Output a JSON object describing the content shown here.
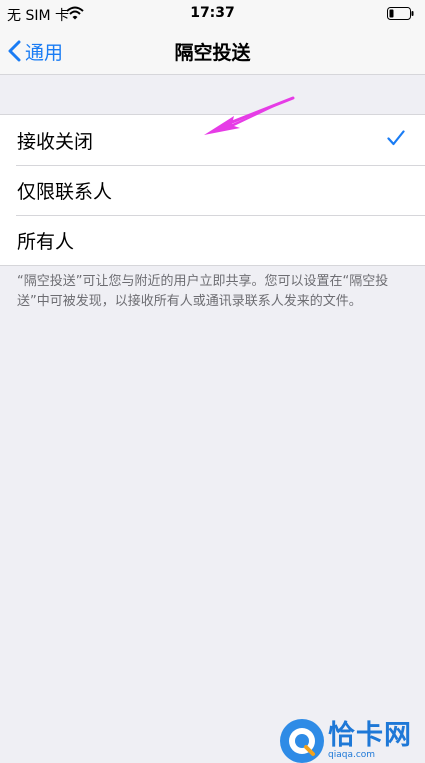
{
  "status_bar": {
    "carrier": "无 SIM 卡",
    "time": "17:37",
    "wifi_icon": "wifi-icon",
    "battery_icon": "battery-icon"
  },
  "nav": {
    "back_label": "通用",
    "title": "隔空投送"
  },
  "options": [
    {
      "label": "接收关闭",
      "selected": true
    },
    {
      "label": "仅限联系人",
      "selected": false
    },
    {
      "label": "所有人",
      "selected": false
    }
  ],
  "footer": "“隔空投送”可让您与附近的用户立即共享。您可以设置在“隔空投送”中可被发现，以接收所有人或通讯录联系人发来的文件。",
  "watermark": {
    "title": "恰卡网",
    "domain": "qiaqa.com"
  },
  "colors": {
    "accent": "#1a7cf4",
    "annotation_arrow": "#e63ce6",
    "background": "#efeff4"
  }
}
